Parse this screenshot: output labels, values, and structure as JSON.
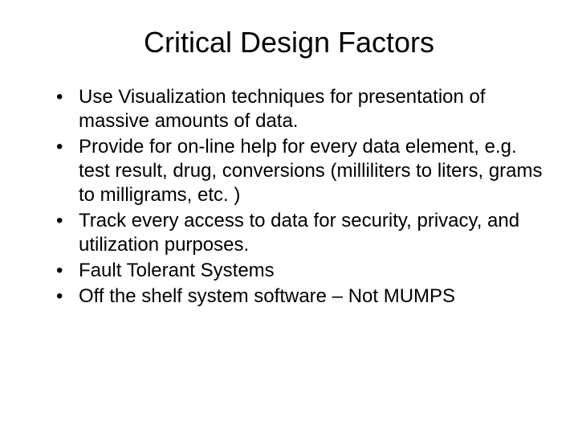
{
  "slide": {
    "title": "Critical Design Factors",
    "bullets": [
      "Use Visualization techniques for presentation of massive amounts of data.",
      "Provide for on-line help for every data element, e.g. test result, drug, conversions (milliliters to liters, grams to milligrams, etc. )",
      "Track every access to data for security, privacy, and utilization purposes.",
      "Fault Tolerant Systems",
      "Off the shelf system software – Not MUMPS"
    ]
  }
}
